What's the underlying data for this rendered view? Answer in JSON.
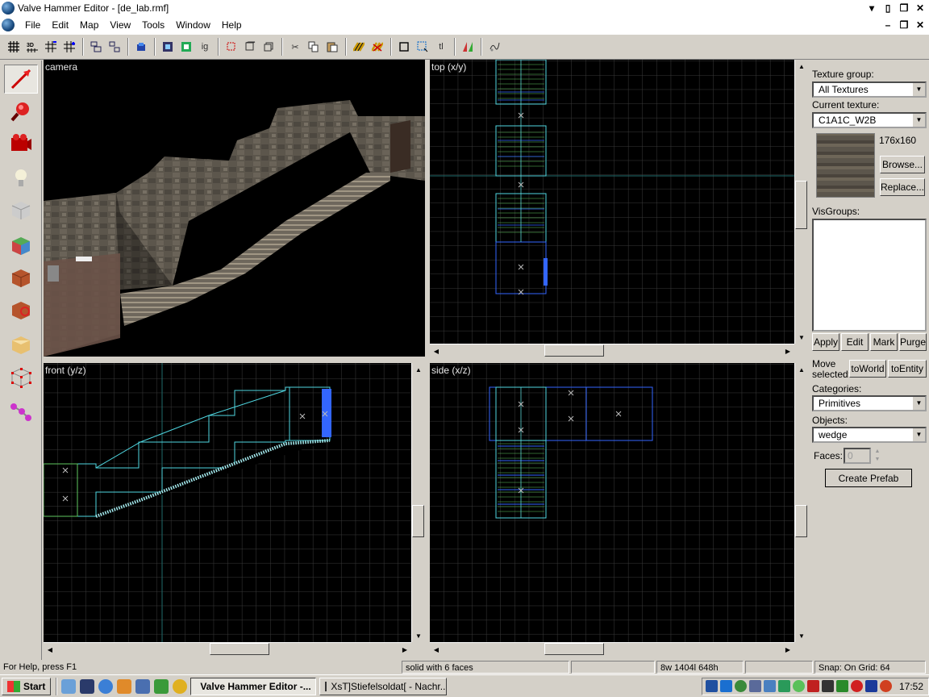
{
  "window": {
    "title": "Valve Hammer Editor - [de_lab.rmf]"
  },
  "menu": [
    "File",
    "Edit",
    "Map",
    "View",
    "Tools",
    "Window",
    "Help"
  ],
  "toolbar_icons": [
    "grid-icon",
    "3d-grid-icon",
    "smaller-grid-icon",
    "larger-grid-icon",
    "group-icon",
    "ungroup-icon",
    "texture-lock-icon",
    "carve-icon",
    "hollow-icon",
    "ignore-groups-icon",
    "undo-icon",
    "redo-icon",
    "paste-special-icon",
    "cut-icon",
    "copy-icon",
    "paste-icon",
    "toggle-texture-icon",
    "hide-items-icon",
    "select-box-icon",
    "select-tool-icon",
    "text-icon",
    "map-properties-icon",
    "entity-report-icon"
  ],
  "toolbar_text": {
    "ig": "ig",
    "tl": "tl"
  },
  "left_tools": [
    "selection-tool-icon",
    "magnify-tool-icon",
    "camera-tool-icon",
    "entity-tool-icon",
    "block-tool-icon",
    "texture-app-icon",
    "apply-texture-icon",
    "decal-tool-icon",
    "clip-tool-icon",
    "vertex-tool-icon",
    "path-tool-icon"
  ],
  "views": {
    "camera": "camera",
    "top": "top (x/y)",
    "front": "front (y/z)",
    "side": "side (x/z)"
  },
  "panel": {
    "texture_group_label": "Texture group:",
    "texture_group_value": "All Textures",
    "current_texture_label": "Current texture:",
    "current_texture_value": "C1A1C_W2B",
    "texture_size": "176x160",
    "browse": "Browse...",
    "replace": "Replace...",
    "visgroups_label": "VisGroups:",
    "apply": "Apply",
    "edit": "Edit",
    "mark": "Mark",
    "purge": "Purge",
    "move_selected_1": "Move",
    "move_selected_2": "selected:",
    "to_world": "toWorld",
    "to_entity": "toEntity",
    "categories_label": "Categories:",
    "categories_value": "Primitives",
    "objects_label": "Objects:",
    "objects_value": "wedge",
    "faces_label": "Faces:",
    "faces_value": "0",
    "create_prefab": "Create Prefab"
  },
  "status": {
    "help": "For Help, press F1",
    "selection": "solid with 6 faces",
    "blank": "",
    "size": "8w 1404l 648h",
    "blank2": "",
    "snap": "Snap: On Grid: 64"
  },
  "taskbar": {
    "start": "Start",
    "tasks": [
      "Valve Hammer Editor -...",
      "XsT]Stiefelsoldat[ - Nachr..."
    ],
    "clock": "17:52"
  },
  "colors": {
    "grid": "#3a3a3a",
    "brush_cyan": "#4fd6e0",
    "brush_blue": "#3366ff",
    "brush_green": "#5fc85f",
    "bg": "#d4d0c8"
  }
}
